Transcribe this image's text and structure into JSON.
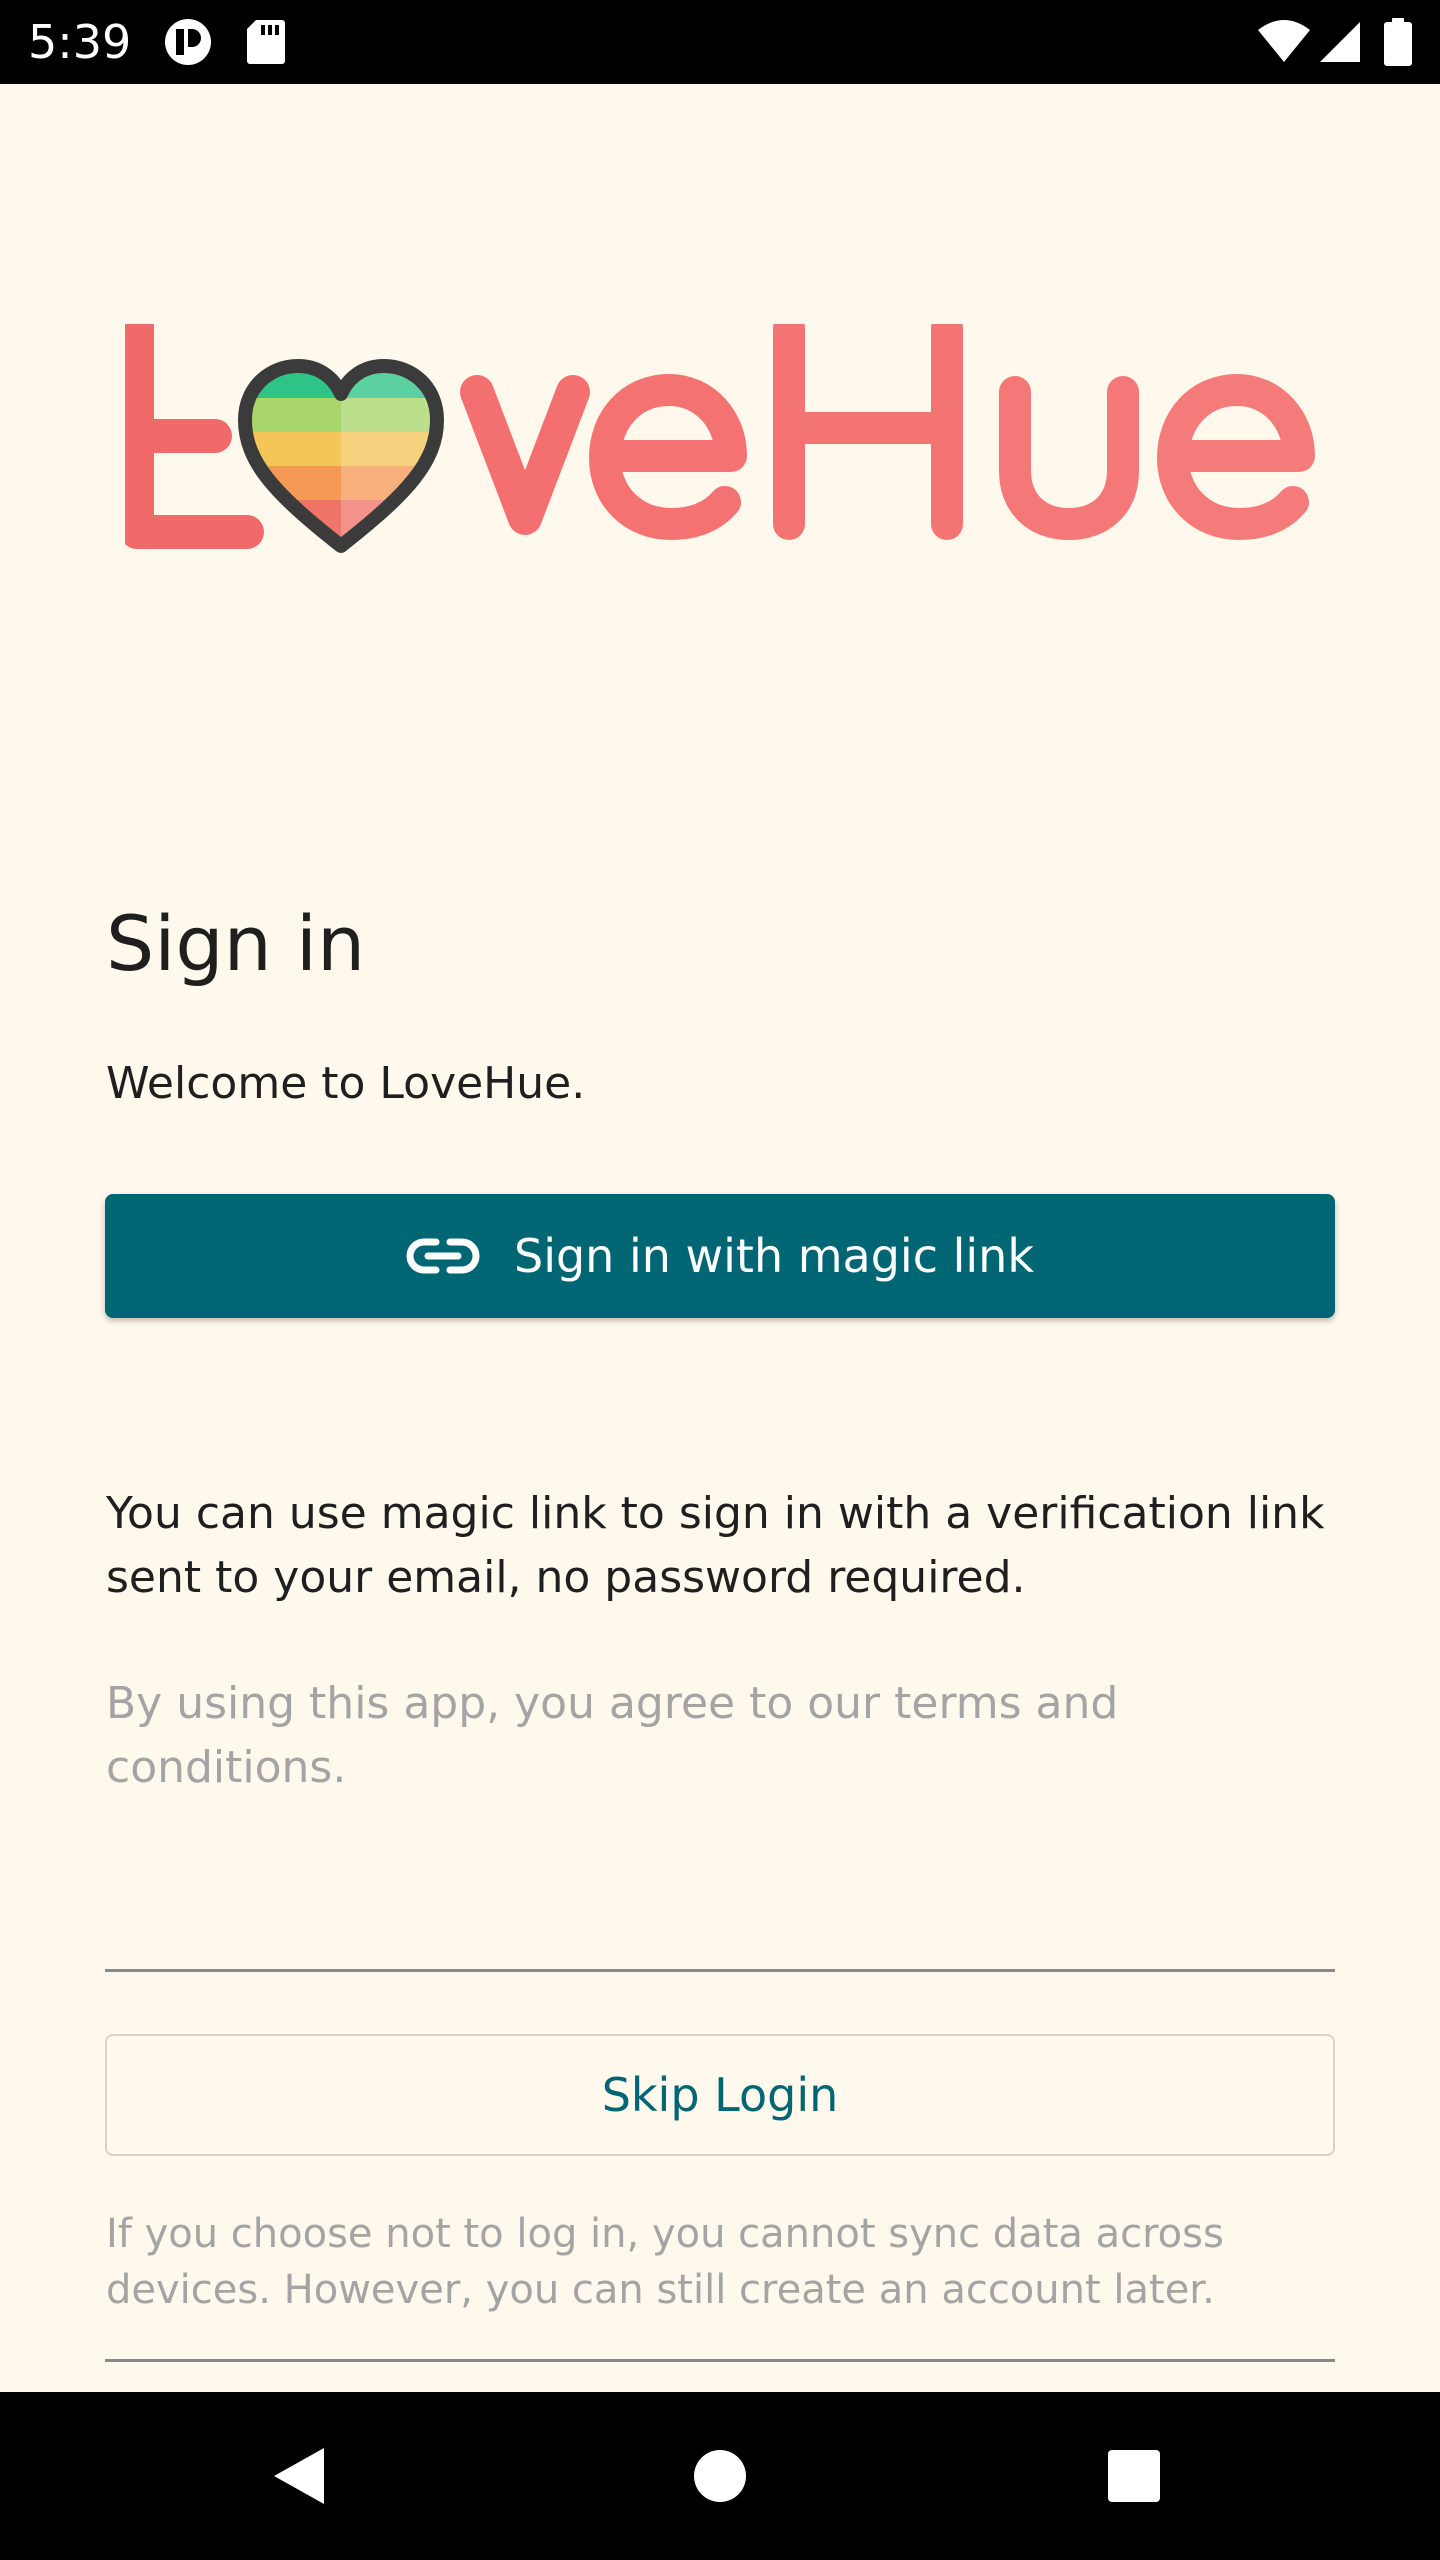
{
  "status_bar": {
    "time": "5:39",
    "icons": [
      "notification-icon",
      "sd-card-icon",
      "wifi-icon",
      "cell-signal-icon",
      "battery-icon"
    ]
  },
  "logo": {
    "text": "LoveHue",
    "colors": {
      "text": "#f47373",
      "heart_outline": "#3b3b3b",
      "stripes": [
        "#2ec486",
        "#a8d66c",
        "#f4c65a",
        "#f59a56",
        "#f07468"
      ]
    }
  },
  "signin": {
    "title": "Sign in",
    "welcome": "Welcome to LoveHue.",
    "magic_button_label": "Sign in with magic link",
    "magic_button_icon": "link-icon",
    "description": "You can use magic link to sign in with a verification link sent to your email, no password required.",
    "terms": "By using this app, you agree to our terms and conditions."
  },
  "skip": {
    "button_label": "Skip Login",
    "note": "If you choose not to log in, you cannot sync data across devices. However, you can still create an account later."
  },
  "nav_bar": {
    "buttons": [
      "back-icon",
      "home-icon",
      "recents-icon"
    ]
  },
  "colors": {
    "background": "#fff8ec",
    "primary": "#006674",
    "text": "#1f1f1f",
    "muted_text": "#a4a4a4"
  }
}
